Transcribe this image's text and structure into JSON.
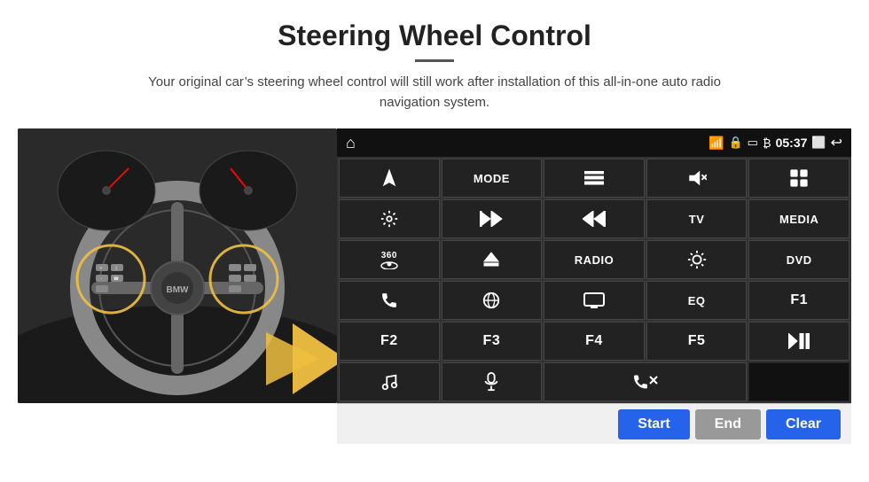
{
  "header": {
    "title": "Steering Wheel Control",
    "subtitle": "Your original car’s steering wheel control will still work after installation of this all-in-one auto radio navigation system."
  },
  "status_bar": {
    "home_icon": "⌂",
    "wifi_icon": "▾",
    "time": "05:37",
    "back_icon": "↶"
  },
  "button_grid": [
    {
      "id": "nav",
      "type": "icon",
      "icon": "nav"
    },
    {
      "id": "mode",
      "type": "text",
      "label": "MODE"
    },
    {
      "id": "menu",
      "type": "icon",
      "icon": "menu"
    },
    {
      "id": "mute",
      "type": "icon",
      "icon": "mute"
    },
    {
      "id": "apps",
      "type": "icon",
      "icon": "apps"
    },
    {
      "id": "settings",
      "type": "icon",
      "icon": "settings"
    },
    {
      "id": "prev",
      "type": "icon",
      "icon": "prev"
    },
    {
      "id": "next",
      "type": "icon",
      "icon": "next"
    },
    {
      "id": "tv",
      "type": "text",
      "label": "TV"
    },
    {
      "id": "media",
      "type": "text",
      "label": "MEDIA"
    },
    {
      "id": "cam360",
      "type": "icon",
      "icon": "360cam"
    },
    {
      "id": "eject",
      "type": "icon",
      "icon": "eject"
    },
    {
      "id": "radio",
      "type": "text",
      "label": "RADIO"
    },
    {
      "id": "brightness",
      "type": "icon",
      "icon": "brightness"
    },
    {
      "id": "dvd",
      "type": "text",
      "label": "DVD"
    },
    {
      "id": "phone",
      "type": "icon",
      "icon": "phone"
    },
    {
      "id": "browse",
      "type": "icon",
      "icon": "browse"
    },
    {
      "id": "display",
      "type": "icon",
      "icon": "display"
    },
    {
      "id": "eq",
      "type": "text",
      "label": "EQ"
    },
    {
      "id": "f1",
      "type": "text",
      "label": "F1"
    },
    {
      "id": "f2",
      "type": "text",
      "label": "F2"
    },
    {
      "id": "f3",
      "type": "text",
      "label": "F3"
    },
    {
      "id": "f4",
      "type": "text",
      "label": "F4"
    },
    {
      "id": "f5",
      "type": "text",
      "label": "F5"
    },
    {
      "id": "playpause",
      "type": "icon",
      "icon": "playpause"
    },
    {
      "id": "music",
      "type": "icon",
      "icon": "music"
    },
    {
      "id": "mic",
      "type": "icon",
      "icon": "mic"
    },
    {
      "id": "phonemute",
      "type": "icon",
      "icon": "phonemute"
    },
    {
      "id": "empty1",
      "type": "empty",
      "label": ""
    },
    {
      "id": "empty2",
      "type": "empty",
      "label": ""
    }
  ],
  "bottom_bar": {
    "start_label": "Start",
    "end_label": "End",
    "clear_label": "Clear"
  }
}
